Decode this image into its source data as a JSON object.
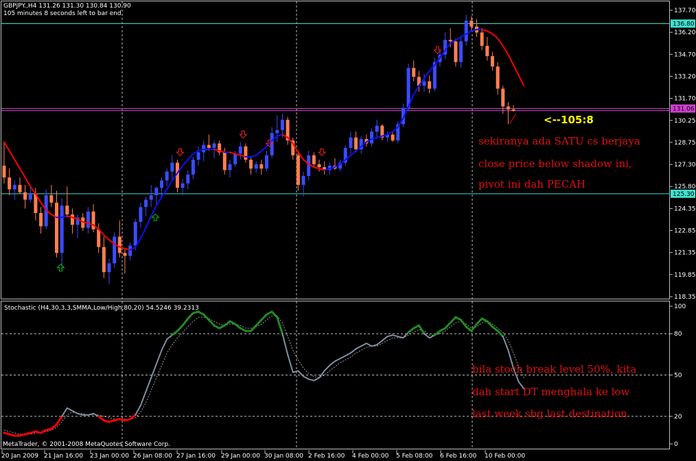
{
  "header": {
    "symbol_line": "GBPJPY.,H4  131.26 131.30 130.84 130.90",
    "timer_line": "105 minutes 8 seconds left to bar end"
  },
  "indicator": {
    "label": "Stochastic (H4,30,3,3,SMMA,Low/High,80,20) 54.5246 39.2313"
  },
  "footer": {
    "copyright": "MetaTrader, © 2001-2008 MetaQuotes Software Corp."
  },
  "annotations": {
    "pivot_callout": "<--105:8",
    "note1_line1": "sekiranya ada SATU cs berjaya",
    "note1_line2": "close price below shadow ini,",
    "note1_line3": "pivot ini dah PECAH",
    "note2_line1": "bila stoch break level 50%, kita",
    "note2_line2": "dah start DT menghala ke low",
    "note2_line3": "last week sbg last destination"
  },
  "colors": {
    "background": "#000000",
    "bull_candle": "#3a4cff",
    "bear_candle": "#ff7f50",
    "ma_up": "#1010ff",
    "ma_down": "#ff0000",
    "stoch_overbought": "#228b22",
    "stoch_oversold": "#ff0000",
    "stoch_main": "#8090a0",
    "stoch_signal": "#a0a0a0",
    "hline_cyan": "#40e0d0",
    "hline_magenta": "#d040d0",
    "grid": "#c0c0c0",
    "arrow_up": "#00c000",
    "arrow_down": "#ff2020"
  },
  "chart_data": [
    {
      "type": "candlestick",
      "symbol": "GBPJPY.",
      "timeframe": "H4",
      "ylim": [
        118.35,
        137.7
      ],
      "y_tick_labels": [
        "137.70",
        "136.20",
        "134.70",
        "133.20",
        "131.70",
        "130.25",
        "128.75",
        "127.30",
        "125.80",
        "124.35",
        "122.85",
        "121.35",
        "119.85",
        "118.35"
      ],
      "x_tick_labels": [
        "20 Jan 2009",
        "21 Jan 16:00",
        "23 Jan 00:00",
        "26 Jan 08:00",
        "27 Jan 16:00",
        "29 Jan 00:00",
        "30 Jan 08:00",
        "2 Feb 16:00",
        "4 Feb 00:00",
        "5 Feb 08:00",
        "6 Feb 16:00",
        "10 Feb 00:00"
      ],
      "vertical_gridlines_at_x_labels": [
        "23 Jan 00:00",
        "30 Jan 08:00",
        "6 Feb 16:00"
      ],
      "horizontal_levels": [
        {
          "value": 136.8,
          "label": "136.80",
          "color": "cyan"
        },
        {
          "value": 131.06,
          "label": "131.06",
          "color": "magenta"
        },
        {
          "value": 130.92,
          "color": "magenta"
        },
        {
          "value": 125.3,
          "label": "125.30",
          "color": "cyan"
        }
      ],
      "candles": [
        {
          "o": 127.2,
          "h": 128.8,
          "l": 126.0,
          "c": 126.4
        },
        {
          "o": 126.4,
          "h": 127.0,
          "l": 125.2,
          "c": 125.6
        },
        {
          "o": 125.6,
          "h": 126.2,
          "l": 124.9,
          "c": 125.9
        },
        {
          "o": 125.9,
          "h": 126.4,
          "l": 125.3,
          "c": 125.4
        },
        {
          "o": 125.4,
          "h": 125.9,
          "l": 124.3,
          "c": 124.9
        },
        {
          "o": 124.9,
          "h": 125.8,
          "l": 124.7,
          "c": 125.3
        },
        {
          "o": 125.3,
          "h": 125.7,
          "l": 123.5,
          "c": 124.0
        },
        {
          "o": 124.0,
          "h": 124.4,
          "l": 122.6,
          "c": 123.1
        },
        {
          "o": 123.1,
          "h": 125.6,
          "l": 122.9,
          "c": 125.2
        },
        {
          "o": 125.2,
          "h": 125.9,
          "l": 124.4,
          "c": 124.7
        },
        {
          "o": 124.7,
          "h": 125.5,
          "l": 121.0,
          "c": 121.3
        },
        {
          "o": 121.3,
          "h": 125.0,
          "l": 120.2,
          "c": 124.5
        },
        {
          "o": 124.5,
          "h": 125.8,
          "l": 123.7,
          "c": 123.9
        },
        {
          "o": 123.9,
          "h": 124.3,
          "l": 122.6,
          "c": 123.2
        },
        {
          "o": 123.2,
          "h": 123.9,
          "l": 122.3,
          "c": 123.7
        },
        {
          "o": 123.7,
          "h": 124.0,
          "l": 122.8,
          "c": 123.0
        },
        {
          "o": 123.0,
          "h": 124.4,
          "l": 122.6,
          "c": 124.1
        },
        {
          "o": 124.1,
          "h": 124.6,
          "l": 122.7,
          "c": 122.9
        },
        {
          "o": 122.9,
          "h": 123.3,
          "l": 121.3,
          "c": 121.7
        },
        {
          "o": 121.7,
          "h": 122.4,
          "l": 119.6,
          "c": 120.0
        },
        {
          "o": 120.0,
          "h": 120.9,
          "l": 119.2,
          "c": 120.6
        },
        {
          "o": 120.6,
          "h": 122.7,
          "l": 120.3,
          "c": 122.4
        },
        {
          "o": 122.4,
          "h": 123.5,
          "l": 121.0,
          "c": 121.3
        },
        {
          "o": 121.3,
          "h": 121.6,
          "l": 119.9,
          "c": 121.1
        },
        {
          "o": 121.1,
          "h": 122.0,
          "l": 120.8,
          "c": 121.8
        },
        {
          "o": 121.8,
          "h": 123.6,
          "l": 121.5,
          "c": 123.4
        },
        {
          "o": 123.4,
          "h": 124.7,
          "l": 123.0,
          "c": 124.4
        },
        {
          "o": 124.4,
          "h": 125.1,
          "l": 123.8,
          "c": 124.9
        },
        {
          "o": 124.9,
          "h": 125.9,
          "l": 124.4,
          "c": 125.2
        },
        {
          "o": 125.2,
          "h": 125.8,
          "l": 124.6,
          "c": 125.7
        },
        {
          "o": 125.7,
          "h": 126.4,
          "l": 125.0,
          "c": 126.2
        },
        {
          "o": 126.2,
          "h": 127.0,
          "l": 125.8,
          "c": 126.8
        },
        {
          "o": 126.8,
          "h": 127.9,
          "l": 126.2,
          "c": 127.4
        },
        {
          "o": 127.4,
          "h": 127.6,
          "l": 125.4,
          "c": 125.7
        },
        {
          "o": 125.7,
          "h": 126.3,
          "l": 125.2,
          "c": 126.0
        },
        {
          "o": 126.0,
          "h": 126.9,
          "l": 125.6,
          "c": 126.6
        },
        {
          "o": 126.6,
          "h": 127.8,
          "l": 126.3,
          "c": 127.6
        },
        {
          "o": 127.6,
          "h": 128.5,
          "l": 127.2,
          "c": 128.1
        },
        {
          "o": 128.1,
          "h": 128.9,
          "l": 127.5,
          "c": 128.6
        },
        {
          "o": 128.6,
          "h": 129.3,
          "l": 128.2,
          "c": 128.4
        },
        {
          "o": 128.4,
          "h": 128.9,
          "l": 127.7,
          "c": 128.7
        },
        {
          "o": 128.7,
          "h": 128.9,
          "l": 127.9,
          "c": 128.1
        },
        {
          "o": 128.1,
          "h": 128.4,
          "l": 126.6,
          "c": 126.9
        },
        {
          "o": 126.9,
          "h": 127.6,
          "l": 126.4,
          "c": 127.3
        },
        {
          "o": 127.3,
          "h": 128.2,
          "l": 127.1,
          "c": 128.0
        },
        {
          "o": 128.0,
          "h": 128.8,
          "l": 127.6,
          "c": 128.5
        },
        {
          "o": 128.5,
          "h": 128.7,
          "l": 127.4,
          "c": 127.6
        },
        {
          "o": 127.6,
          "h": 127.8,
          "l": 126.6,
          "c": 127.0
        },
        {
          "o": 127.0,
          "h": 127.5,
          "l": 126.7,
          "c": 127.3
        },
        {
          "o": 127.3,
          "h": 127.6,
          "l": 126.6,
          "c": 127.0
        },
        {
          "o": 127.0,
          "h": 128.2,
          "l": 126.8,
          "c": 127.9
        },
        {
          "o": 127.9,
          "h": 129.8,
          "l": 127.7,
          "c": 129.4
        },
        {
          "o": 129.4,
          "h": 130.6,
          "l": 128.8,
          "c": 129.6
        },
        {
          "o": 129.6,
          "h": 130.7,
          "l": 129.1,
          "c": 130.3
        },
        {
          "o": 130.3,
          "h": 130.5,
          "l": 128.6,
          "c": 128.9
        },
        {
          "o": 128.9,
          "h": 129.1,
          "l": 127.6,
          "c": 127.9
        },
        {
          "o": 127.9,
          "h": 128.2,
          "l": 125.5,
          "c": 125.9
        },
        {
          "o": 125.9,
          "h": 126.8,
          "l": 125.1,
          "c": 126.5
        },
        {
          "o": 126.5,
          "h": 128.2,
          "l": 126.2,
          "c": 127.9
        },
        {
          "o": 127.9,
          "h": 128.1,
          "l": 127.1,
          "c": 127.3
        },
        {
          "o": 127.3,
          "h": 127.6,
          "l": 126.8,
          "c": 127.1
        },
        {
          "o": 127.1,
          "h": 127.5,
          "l": 126.6,
          "c": 126.9
        },
        {
          "o": 126.9,
          "h": 127.4,
          "l": 126.6,
          "c": 127.2
        },
        {
          "o": 127.2,
          "h": 127.7,
          "l": 126.9,
          "c": 127.0
        },
        {
          "o": 127.0,
          "h": 127.6,
          "l": 126.8,
          "c": 127.4
        },
        {
          "o": 127.4,
          "h": 128.6,
          "l": 127.2,
          "c": 128.4
        },
        {
          "o": 128.4,
          "h": 129.5,
          "l": 128.0,
          "c": 129.1
        },
        {
          "o": 129.1,
          "h": 129.5,
          "l": 128.1,
          "c": 128.3
        },
        {
          "o": 128.3,
          "h": 129.2,
          "l": 128.0,
          "c": 129.0
        },
        {
          "o": 129.0,
          "h": 129.3,
          "l": 128.5,
          "c": 128.7
        },
        {
          "o": 128.7,
          "h": 129.7,
          "l": 128.5,
          "c": 129.5
        },
        {
          "o": 129.5,
          "h": 130.3,
          "l": 129.0,
          "c": 129.9
        },
        {
          "o": 129.9,
          "h": 130.0,
          "l": 128.9,
          "c": 129.1
        },
        {
          "o": 129.1,
          "h": 129.5,
          "l": 128.8,
          "c": 129.3
        },
        {
          "o": 129.3,
          "h": 129.5,
          "l": 128.8,
          "c": 128.9
        },
        {
          "o": 128.9,
          "h": 130.2,
          "l": 128.7,
          "c": 130.0
        },
        {
          "o": 130.0,
          "h": 131.4,
          "l": 129.8,
          "c": 131.1
        },
        {
          "o": 131.1,
          "h": 134.1,
          "l": 130.9,
          "c": 133.8
        },
        {
          "o": 133.8,
          "h": 134.3,
          "l": 132.9,
          "c": 133.2
        },
        {
          "o": 133.2,
          "h": 133.6,
          "l": 132.2,
          "c": 132.6
        },
        {
          "o": 132.6,
          "h": 133.4,
          "l": 132.2,
          "c": 132.9
        },
        {
          "o": 132.9,
          "h": 133.3,
          "l": 132.1,
          "c": 132.4
        },
        {
          "o": 132.4,
          "h": 134.5,
          "l": 132.2,
          "c": 134.2
        },
        {
          "o": 134.2,
          "h": 135.0,
          "l": 133.9,
          "c": 134.7
        },
        {
          "o": 134.7,
          "h": 136.2,
          "l": 134.4,
          "c": 135.7
        },
        {
          "o": 135.7,
          "h": 136.5,
          "l": 135.2,
          "c": 135.6
        },
        {
          "o": 135.6,
          "h": 135.8,
          "l": 133.9,
          "c": 134.2
        },
        {
          "o": 134.2,
          "h": 135.9,
          "l": 133.8,
          "c": 135.6
        },
        {
          "o": 135.6,
          "h": 137.4,
          "l": 135.3,
          "c": 137.0
        },
        {
          "o": 137.0,
          "h": 137.3,
          "l": 136.3,
          "c": 136.6
        },
        {
          "o": 136.6,
          "h": 137.1,
          "l": 135.9,
          "c": 136.2
        },
        {
          "o": 136.2,
          "h": 136.5,
          "l": 135.0,
          "c": 135.3
        },
        {
          "o": 135.3,
          "h": 135.9,
          "l": 134.3,
          "c": 134.6
        },
        {
          "o": 134.6,
          "h": 134.9,
          "l": 133.6,
          "c": 133.9
        },
        {
          "o": 133.9,
          "h": 134.2,
          "l": 132.0,
          "c": 132.4
        },
        {
          "o": 132.4,
          "h": 132.6,
          "l": 130.7,
          "c": 131.2
        },
        {
          "o": 131.2,
          "h": 131.5,
          "l": 130.0,
          "c": 131.0
        },
        {
          "o": 131.0,
          "h": 131.3,
          "l": 130.84,
          "c": 130.9
        }
      ],
      "moving_average": [
        128.8,
        128.2,
        127.6,
        127.0,
        126.4,
        125.8,
        125.3,
        124.7,
        124.2,
        123.9,
        123.7,
        123.7,
        123.8,
        123.7,
        123.6,
        123.4,
        123.3,
        123.2,
        122.9,
        122.5,
        122.2,
        121.9,
        121.7,
        121.6,
        121.5,
        121.7,
        122.3,
        123.0,
        123.8,
        124.5,
        125.1,
        125.6,
        126.2,
        126.7,
        127.2,
        127.6,
        128.0,
        128.2,
        128.3,
        128.3,
        128.3,
        128.2,
        128.1,
        128.1,
        128.0,
        127.9,
        127.8,
        127.8,
        127.9,
        128.2,
        128.5,
        128.9,
        129.2,
        129.3,
        129.1,
        128.7,
        128.1,
        127.6,
        127.3,
        127.1,
        127.0,
        126.9,
        127.0,
        127.1,
        127.3,
        127.6,
        127.9,
        128.2,
        128.5,
        128.8,
        129.0,
        129.1,
        129.2,
        129.3,
        129.5,
        129.8,
        130.4,
        131.2,
        132.0,
        132.6,
        133.1,
        133.6,
        134.0,
        134.5,
        135.0,
        135.5,
        135.7,
        135.9,
        136.1,
        136.3,
        136.4,
        136.4,
        136.3,
        136.1,
        135.8,
        135.3,
        134.7,
        134.0,
        133.3,
        132.6
      ],
      "buy_arrows_at_candle": [
        10,
        28
      ],
      "sell_arrows_at_candle": [
        33,
        45,
        50,
        60,
        82
      ]
    },
    {
      "type": "line",
      "title": "Stochastic (H4,30,3,3,SMMA,Low/High,80,20)",
      "main_value": 54.5246,
      "signal_value": 39.2313,
      "ylim": [
        0,
        100
      ],
      "y_tick_labels": [
        "100",
        "80",
        "50",
        "20",
        "0"
      ],
      "levels": [
        80,
        50,
        20
      ],
      "main_line": [
        8,
        7,
        6,
        6,
        7,
        8,
        9,
        8,
        10,
        11,
        14,
        20,
        26,
        24,
        22,
        21,
        21,
        22,
        20,
        17,
        16,
        17,
        18,
        17,
        18,
        21,
        28,
        38,
        48,
        58,
        68,
        76,
        79,
        82,
        86,
        91,
        95,
        96,
        94,
        90,
        86,
        84,
        86,
        89,
        87,
        84,
        82,
        82,
        86,
        90,
        94,
        96,
        92,
        80,
        65,
        52,
        53,
        49,
        47,
        46,
        48,
        53,
        57,
        60,
        62,
        64,
        66,
        69,
        71,
        73,
        71,
        72,
        75,
        78,
        79,
        78,
        77,
        81,
        84,
        86,
        80,
        77,
        79,
        82,
        84,
        88,
        92,
        90,
        85,
        82,
        87,
        91,
        89,
        85,
        82,
        78,
        68,
        55,
        45,
        40
      ],
      "signal_line": [
        10,
        9,
        8,
        7,
        7,
        7,
        8,
        8,
        9,
        10,
        12,
        16,
        21,
        23,
        22,
        22,
        21,
        21,
        21,
        20,
        19,
        18,
        18,
        18,
        18,
        19,
        23,
        30,
        39,
        48,
        57,
        66,
        72,
        77,
        81,
        85,
        89,
        92,
        92,
        91,
        89,
        87,
        86,
        87,
        87,
        86,
        84,
        84,
        85,
        87,
        90,
        93,
        93,
        88,
        78,
        68,
        61,
        55,
        51,
        49,
        48,
        50,
        53,
        56,
        59,
        61,
        63,
        66,
        68,
        70,
        71,
        71,
        73,
        75,
        77,
        77,
        77,
        79,
        81,
        83,
        82,
        79,
        79,
        80,
        82,
        85,
        88,
        89,
        87,
        84,
        85,
        88,
        89,
        87,
        84,
        81,
        75,
        66,
        56,
        48
      ]
    }
  ]
}
